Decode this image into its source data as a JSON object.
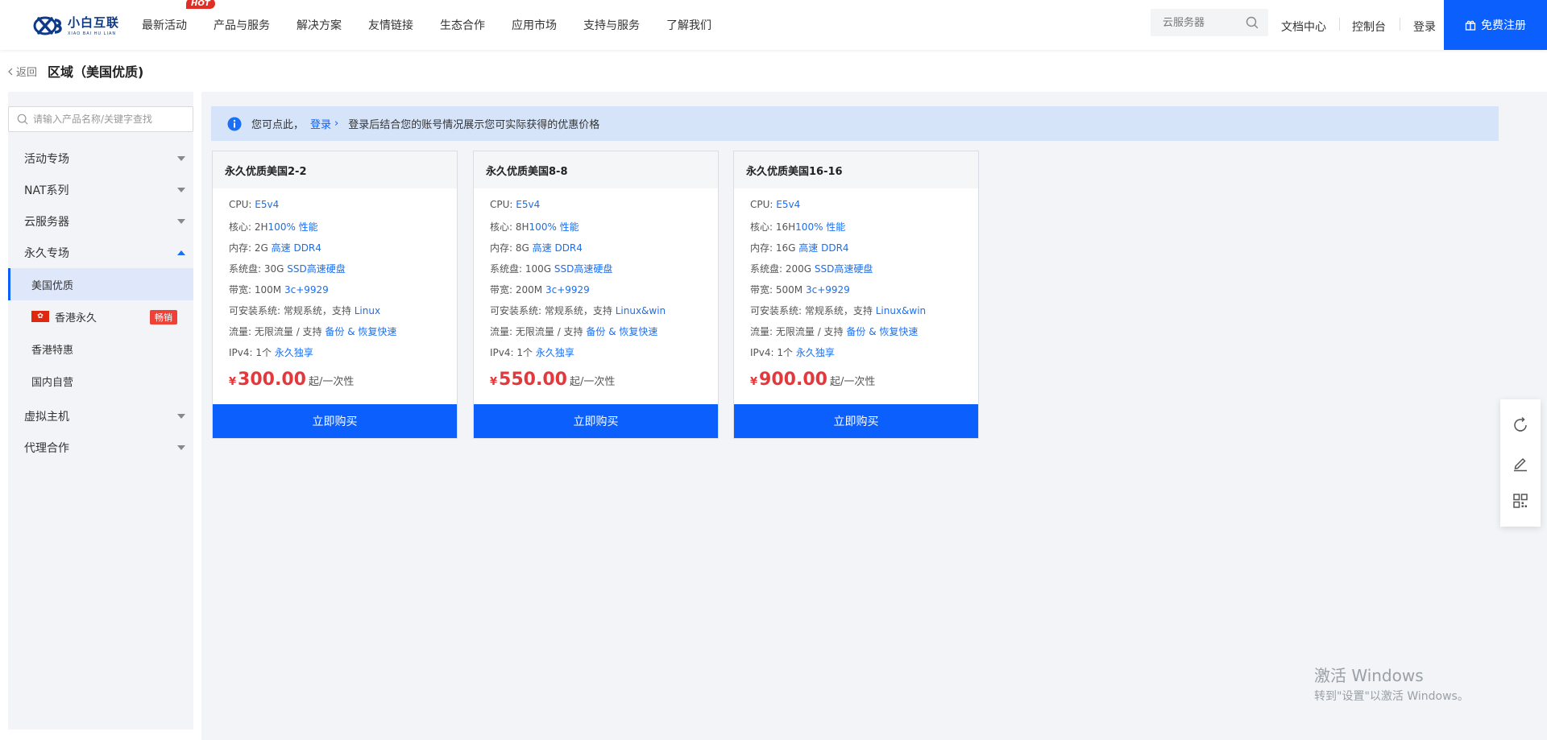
{
  "header": {
    "logo_cn": "小白互联",
    "logo_en": "XIAO BAI HU LIAN",
    "nav": [
      {
        "label": "最新活动",
        "badge": "HOT"
      },
      {
        "label": "产品与服务"
      },
      {
        "label": "解决方案"
      },
      {
        "label": "友情链接"
      },
      {
        "label": "生态合作"
      },
      {
        "label": "应用市场"
      },
      {
        "label": "支持与服务"
      },
      {
        "label": "了解我们"
      }
    ],
    "search_placeholder": "云服务器",
    "links": {
      "docs": "文档中心",
      "console": "控制台",
      "login": "登录"
    },
    "register": "免费注册",
    "colors": {
      "primary": "#0b5ffd",
      "hot": "#e02e24"
    }
  },
  "breadcrumb": {
    "back": "返回",
    "title": "区域（美国优质)"
  },
  "sidebar": {
    "search_placeholder": "请输入产品名称/关键字查找",
    "menu": {
      "activity": "活动专场",
      "nat": "NAT系列",
      "cloud": "云服务器",
      "permanent": "永久专场",
      "sub": {
        "us": "美国优质",
        "hk": "香港永久",
        "hk_badge": "畅销",
        "hk_special": "香港特惠",
        "domestic": "国内自营"
      },
      "vhost": "虚拟主机",
      "agent": "代理合作"
    }
  },
  "notice": {
    "prefix": "您可点此，",
    "login": "登录",
    "suffix": "登录后结合您的账号情况展示您可实际获得的优惠价格"
  },
  "labels": {
    "cpu": "CPU:",
    "cores": "核心:",
    "memory": "内存:",
    "disk": "系统盘:",
    "bandwidth": "带宽:",
    "os": "可安装系统:",
    "traffic": "流量:",
    "ipv4": "IPv4:",
    "price_unit": "起/一次性",
    "yen": "¥",
    "buy": "立即购买"
  },
  "products": [
    {
      "name": "永久优质美国2-2",
      "cpu": "E5v4",
      "cores_val": "2H",
      "cores_hl": "100% 性能",
      "mem_val": "2G",
      "mem_hl": "高速 DDR4",
      "disk_val": "30G",
      "disk_hl": "SSD高速硬盘",
      "bw_val": "100M",
      "bw_hl": "3c+9929",
      "os_val": "常规系统，支持",
      "os_hl": "Linux",
      "traffic_val": "无限流量 / 支持",
      "traffic_hl": "备份 & 恢复快速",
      "ipv4_val": "1个",
      "ipv4_hl": "永久独享",
      "price": "300.00"
    },
    {
      "name": "永久优质美国8-8",
      "cpu": "E5v4",
      "cores_val": "8H",
      "cores_hl": "100% 性能",
      "mem_val": "8G",
      "mem_hl": "高速 DDR4",
      "disk_val": "100G",
      "disk_hl": "SSD高速硬盘",
      "bw_val": "200M",
      "bw_hl": "3c+9929",
      "os_val": "常规系统，支持",
      "os_hl": "Linux&win",
      "traffic_val": "无限流量 / 支持",
      "traffic_hl": "备份 & 恢复快速",
      "ipv4_val": "1个",
      "ipv4_hl": "永久独享",
      "price": "550.00"
    },
    {
      "name": "永久优质美国16-16",
      "cpu": "E5v4",
      "cores_val": "16H",
      "cores_hl": "100% 性能",
      "mem_val": "16G",
      "mem_hl": "高速 DDR4",
      "disk_val": "200G",
      "disk_hl": "SSD高速硬盘",
      "bw_val": "500M",
      "bw_hl": "3c+9929",
      "os_val": "常规系统，支持",
      "os_hl": "Linux&win",
      "traffic_val": "无限流量 / 支持",
      "traffic_hl": "备份 & 恢复快速",
      "ipv4_val": "1个",
      "ipv4_hl": "永久独享",
      "price": "900.00"
    }
  ],
  "float_bar": [
    "refresh-icon",
    "edit-icon",
    "qrcode-icon"
  ],
  "watermark": {
    "line1": "激活 Windows",
    "line2": "转到\"设置\"以激活 Windows。"
  }
}
